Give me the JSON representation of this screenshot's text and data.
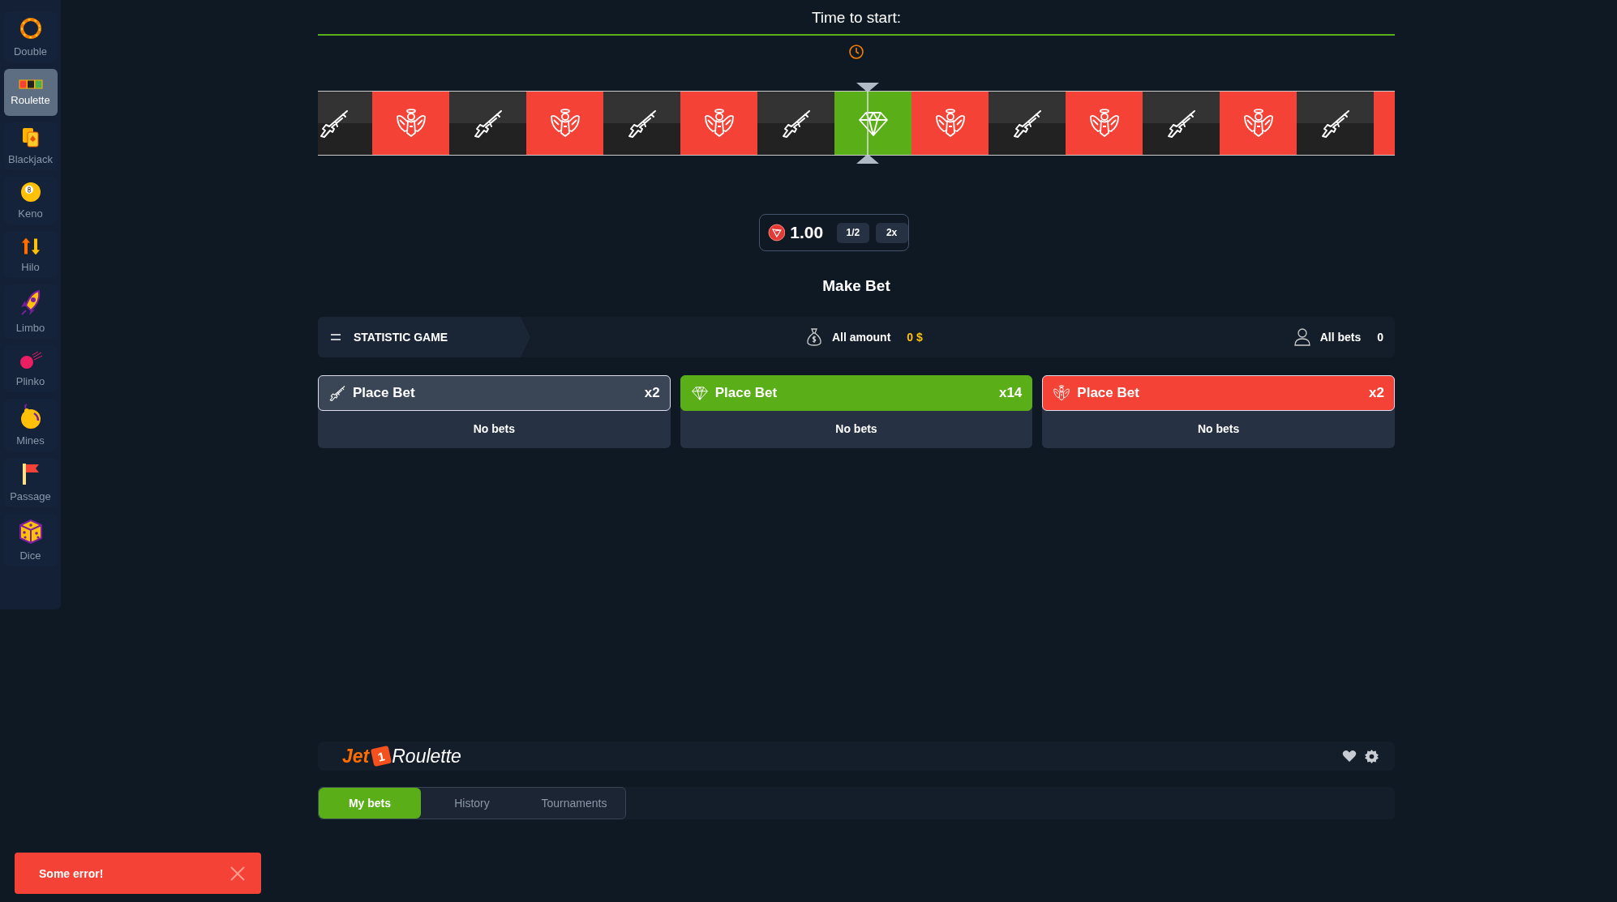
{
  "sidebar": {
    "items": [
      {
        "label": "Double",
        "selected": false
      },
      {
        "label": "Roulette",
        "selected": true
      },
      {
        "label": "Blackjack",
        "selected": false
      },
      {
        "label": "Keno",
        "selected": false
      },
      {
        "label": "Hilo",
        "selected": false
      },
      {
        "label": "Limbo",
        "selected": false
      },
      {
        "label": "Plinko",
        "selected": false
      },
      {
        "label": "Mines",
        "selected": false
      },
      {
        "label": "Passage",
        "selected": false
      },
      {
        "label": "Dice",
        "selected": false
      }
    ]
  },
  "timer": {
    "label": "Time to start:"
  },
  "strip": {
    "tiles": [
      {
        "kind": "gun"
      },
      {
        "kind": "angel"
      },
      {
        "kind": "gun"
      },
      {
        "kind": "angel"
      },
      {
        "kind": "gun"
      },
      {
        "kind": "angel"
      },
      {
        "kind": "gun"
      },
      {
        "kind": "diamond"
      },
      {
        "kind": "angel"
      },
      {
        "kind": "gun"
      },
      {
        "kind": "angel"
      },
      {
        "kind": "gun"
      },
      {
        "kind": "angel"
      },
      {
        "kind": "gun"
      },
      {
        "kind": "red"
      }
    ]
  },
  "bet_input": {
    "amount": "1.00",
    "buttons": [
      "1/2",
      "2x"
    ]
  },
  "make_bet": "Make Bet",
  "statistics": {
    "title": "STATISTIC GAME",
    "amount_label": "All amount",
    "amount_value": "0 $",
    "bets_label": "All bets",
    "bets_value": "0"
  },
  "bets": [
    {
      "kind": "gun",
      "label": "Place Bet",
      "multiplier": "x2",
      "status": "No bets"
    },
    {
      "kind": "diamond",
      "label": "Place Bet",
      "multiplier": "x14",
      "status": "No bets"
    },
    {
      "kind": "angel",
      "label": "Place Bet",
      "multiplier": "x2",
      "status": "No bets"
    }
  ],
  "footer": {
    "logo_prefix": "Jet",
    "logo_badge": "1",
    "logo_suffix": "Roulette"
  },
  "tabs": [
    {
      "label": "My bets",
      "selected": true
    },
    {
      "label": "History",
      "selected": false
    },
    {
      "label": "Tournaments",
      "selected": false
    }
  ],
  "toast": {
    "message": "Some error!"
  }
}
